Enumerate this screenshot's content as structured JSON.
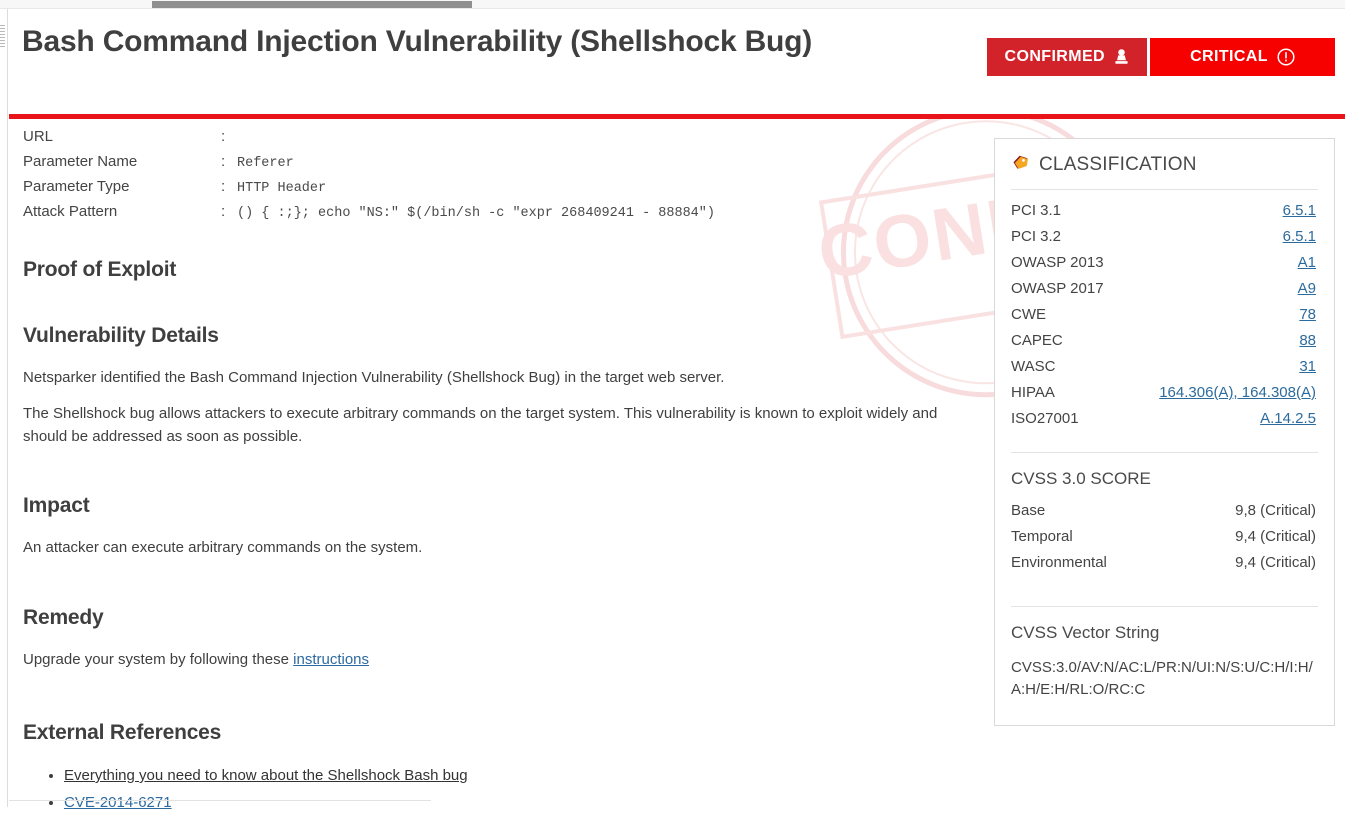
{
  "window": {
    "scrollbar_horizontal": "horizontal-scrollbar"
  },
  "header": {
    "title": "Bash Command Injection Vulnerability (Shellshock Bug)",
    "badges": [
      {
        "label": "CONFIRMED",
        "icon": "stamp-icon",
        "color": "#d2232a"
      },
      {
        "label": "CRITICAL",
        "icon": "exclamation-circle-icon",
        "color": "#f70000"
      }
    ],
    "accent_rule_color": "#e8141a"
  },
  "watermark": {
    "text": "CONFIRMED",
    "color": "#f6c3c5"
  },
  "details": {
    "rows": [
      {
        "label": "URL",
        "separator": ":",
        "value": ""
      },
      {
        "label": "Parameter Name",
        "separator": ":",
        "value": "Referer"
      },
      {
        "label": "Parameter Type",
        "separator": ":",
        "value": "HTTP Header"
      },
      {
        "label": "Attack Pattern",
        "separator": ":",
        "value": "() { :;}; echo \"NS:\" $(/bin/sh -c \"expr 268409241 - 88884\")"
      }
    ]
  },
  "sections": {
    "proof_of_exploit": {
      "heading": "Proof of Exploit"
    },
    "vulnerability_details": {
      "heading": "Vulnerability Details",
      "paragraph1": "Netsparker identified the Bash Command Injection Vulnerability (Shellshock Bug) in the target web server.",
      "paragraph2": "The Shellshock bug allows attackers to execute arbitrary commands on the target system. This vulnerability is known to exploit widely and should be addressed as soon as possible."
    },
    "impact": {
      "heading": "Impact",
      "paragraph": "An attacker can execute arbitrary commands on the system."
    },
    "remedy": {
      "heading": "Remedy",
      "text_before_link": "Upgrade your system by following these ",
      "link_label": "instructions"
    },
    "external_references": {
      "heading": "External References",
      "items": [
        {
          "label": "Everything you need to know about the Shellshock Bash bug"
        },
        {
          "label": "CVE-2014-6271"
        }
      ]
    }
  },
  "classification_panel": {
    "icon": "tag-icon",
    "title": "CLASSIFICATION",
    "rows": [
      {
        "label": "PCI 3.1",
        "value": "6.5.1",
        "is_link": true
      },
      {
        "label": "PCI 3.2",
        "value": "6.5.1",
        "is_link": true
      },
      {
        "label": "OWASP 2013",
        "value": "A1",
        "is_link": true
      },
      {
        "label": "OWASP 2017",
        "value": "A9",
        "is_link": true
      },
      {
        "label": "CWE",
        "value": "78",
        "is_link": true
      },
      {
        "label": "CAPEC",
        "value": "88",
        "is_link": true
      },
      {
        "label": "WASC",
        "value": "31",
        "is_link": true
      },
      {
        "label": "HIPAA",
        "value": "164.306(A), 164.308(A)",
        "is_link": true
      },
      {
        "label": "ISO27001",
        "value": "A.14.2.5",
        "is_link": true
      }
    ],
    "cvss_score": {
      "title": "CVSS 3.0 SCORE",
      "rows": [
        {
          "label": "Base",
          "value": "9,8 (Critical)"
        },
        {
          "label": "Temporal",
          "value": "9,4 (Critical)"
        },
        {
          "label": "Environmental",
          "value": "9,4 (Critical)"
        }
      ]
    },
    "cvss_vector": {
      "title": "CVSS Vector String",
      "value": "CVSS:3.0/AV:N/AC:L/PR:N/UI:N/S:U/C:H/I:H/A:H/E:H/RL:O/RC:C"
    }
  }
}
